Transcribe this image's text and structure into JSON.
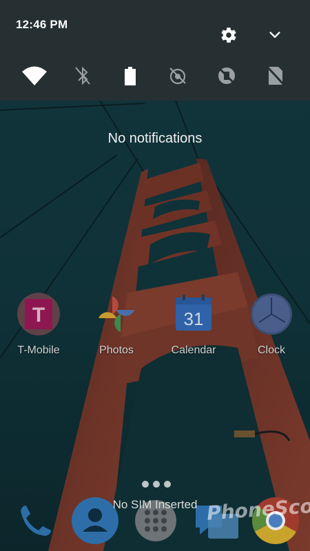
{
  "status": {
    "time": "12:46 PM"
  },
  "header_icons": [
    "settings-gear-icon",
    "collapse-chevron-icon"
  ],
  "quick_settings": [
    {
      "name": "wifi",
      "icon": "wifi-icon",
      "state": "on"
    },
    {
      "name": "bluetooth",
      "icon": "bluetooth-off-icon",
      "state": "off"
    },
    {
      "name": "battery",
      "icon": "battery-icon",
      "state": "on"
    },
    {
      "name": "do-not-disturb",
      "icon": "dnd-off-icon",
      "state": "off"
    },
    {
      "name": "rotation",
      "icon": "rotation-off-icon",
      "state": "off"
    },
    {
      "name": "sim",
      "icon": "no-sim-icon",
      "state": "off"
    }
  ],
  "notifications": {
    "empty_text": "No notifications"
  },
  "apps": [
    {
      "label": "T-Mobile",
      "icon": "t-mobile-icon",
      "color": "#e20074"
    },
    {
      "label": "Photos",
      "icon": "photos-pinwheel-icon"
    },
    {
      "label": "Calendar",
      "icon": "calendar-icon",
      "day": "31",
      "color": "#3d7ed6"
    },
    {
      "label": "Clock",
      "icon": "clock-icon",
      "color": "#536a9e"
    }
  ],
  "bottom": {
    "sim_text": "No SIM Inserted"
  },
  "dock": [
    "phone-icon",
    "contacts-icon",
    "app-drawer-icon",
    "messages-icon",
    "chrome-icon"
  ],
  "watermark": "PhoneScoop"
}
